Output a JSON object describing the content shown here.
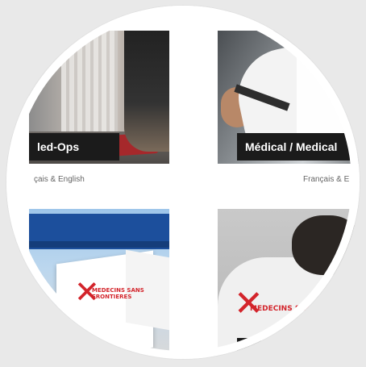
{
  "tiles": [
    {
      "caption": "led-Ops",
      "language": "çais & English"
    },
    {
      "caption": "Médical / Medical",
      "language": "Français & E"
    },
    {
      "caption": "",
      "language": "",
      "logo_text": "MEDECINS SANS FRONTIERES"
    },
    {
      "caption": "",
      "language": "",
      "logo_text": "MEDECINS SANS FRO"
    }
  ],
  "colors": {
    "caption_bg": "#1b1b1b",
    "msf_red": "#d3242b",
    "tent_blue": "#1c4f9c"
  }
}
